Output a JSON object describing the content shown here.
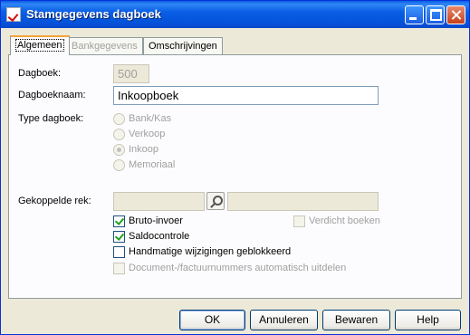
{
  "window": {
    "title": "Stamgegevens dagboek"
  },
  "tabs": [
    {
      "label": "Algemeen",
      "state": "active"
    },
    {
      "label": "Bankgegevens",
      "state": "disabled"
    },
    {
      "label": "Omschrijvingen",
      "state": "normal"
    }
  ],
  "form": {
    "dagboek_label": "Dagboek:",
    "dagboek_value": "500",
    "dagboeknaam_label": "Dagboeknaam:",
    "dagboeknaam_value": "Inkoopboek",
    "type_label": "Type dagboek:",
    "type_options": [
      {
        "label": "Bank/Kas",
        "selected": false
      },
      {
        "label": "Verkoop",
        "selected": false
      },
      {
        "label": "Inkoop",
        "selected": true
      },
      {
        "label": "Memoriaal",
        "selected": false
      }
    ],
    "gekoppelde_label": "Gekoppelde rek:",
    "gekoppelde_value": "",
    "gekoppelde_desc": "",
    "checkboxes": [
      {
        "label": "Bruto-invoer",
        "checked": true,
        "enabled": true
      },
      {
        "label": "Verdicht boeken",
        "checked": false,
        "enabled": false
      },
      {
        "label": "Saldocontrole",
        "checked": true,
        "enabled": true
      },
      {
        "label": "Handmatige wijzigingen geblokkeerd",
        "checked": false,
        "enabled": true
      },
      {
        "label": "Document-/factuurnummers automatisch uitdelen",
        "checked": false,
        "enabled": false
      }
    ]
  },
  "buttons": {
    "ok": "OK",
    "cancel": "Annuleren",
    "save": "Bewaren",
    "help": "Help"
  },
  "icons": {
    "app": "checkmark-document-icon",
    "search": "magnifier-icon"
  },
  "colors": {
    "titlebar": "#0a5fe6",
    "dialog_bg": "#ece9d8",
    "active_tab_accent": "#f3a43a",
    "disabled_text": "#a0a0a0",
    "check": "#21a121"
  }
}
